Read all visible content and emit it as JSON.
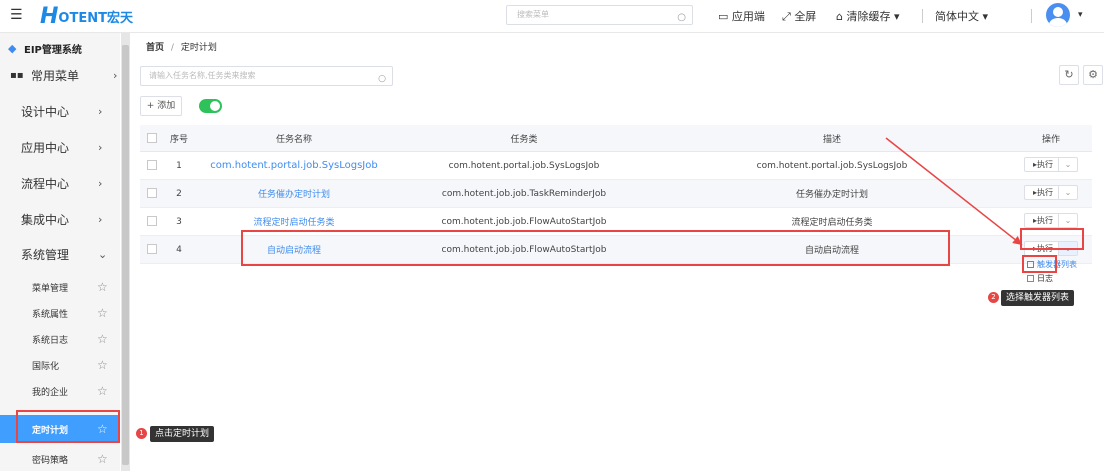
{
  "header": {
    "logo_h": "H",
    "logo_rest": "OTENT宏天",
    "search_placeholder": "搜索菜单",
    "app_end": "应用端",
    "fullscreen": "全屏",
    "clear_cache": "清除缓存",
    "language": "简体中文"
  },
  "sidebar": {
    "system_title": "EIP管理系统",
    "items": [
      {
        "label": "常用菜单"
      },
      {
        "label": "设计中心"
      },
      {
        "label": "应用中心"
      },
      {
        "label": "流程中心"
      },
      {
        "label": "集成中心"
      },
      {
        "label": "系统管理"
      }
    ],
    "sub_items": [
      {
        "label": "菜单管理"
      },
      {
        "label": "系统属性"
      },
      {
        "label": "系统日志"
      },
      {
        "label": "国际化"
      },
      {
        "label": "我的企业"
      },
      {
        "label": "定时计划"
      },
      {
        "label": "密码策略"
      }
    ]
  },
  "breadcrumb": {
    "home": "首页",
    "sep": "/",
    "current": "定时计划"
  },
  "main": {
    "search_placeholder": "请输入任务名称,任务类来搜索",
    "add_label": "+ 添加"
  },
  "table": {
    "headers": [
      "序号",
      "任务名称",
      "任务类",
      "描述",
      "操作"
    ],
    "rows": [
      {
        "no": "1",
        "name": "com.hotent.portal.job.SysLogsJob",
        "cls": "com.hotent.portal.job.SysLogsJob",
        "desc": "com.hotent.portal.job.SysLogsJob",
        "action": "▸执行"
      },
      {
        "no": "2",
        "name": "任务催办定时计划",
        "cls": "com.hotent.job.job.TaskReminderJob",
        "desc": "任务催办定时计划",
        "action": "▸执行"
      },
      {
        "no": "3",
        "name": "流程定时启动任务类",
        "cls": "com.hotent.job.job.FlowAutoStartJob",
        "desc": "流程定时启动任务类",
        "action": "▸执行"
      },
      {
        "no": "4",
        "name": "自动启动流程",
        "cls": "com.hotent.job.job.FlowAutoStartJob",
        "desc": "自动启动流程",
        "action": "▸执行"
      }
    ]
  },
  "dropdown": {
    "trigger_list": "触发器列表",
    "log": "日志"
  },
  "annotations": {
    "badge1": "1",
    "tip1": "点击定时计划",
    "badge2": "2",
    "tip2": "选择触发器列表"
  },
  "colors": {
    "accent": "#409eff",
    "highlight": "#e84545",
    "toggle_on": "#2fc25b"
  }
}
